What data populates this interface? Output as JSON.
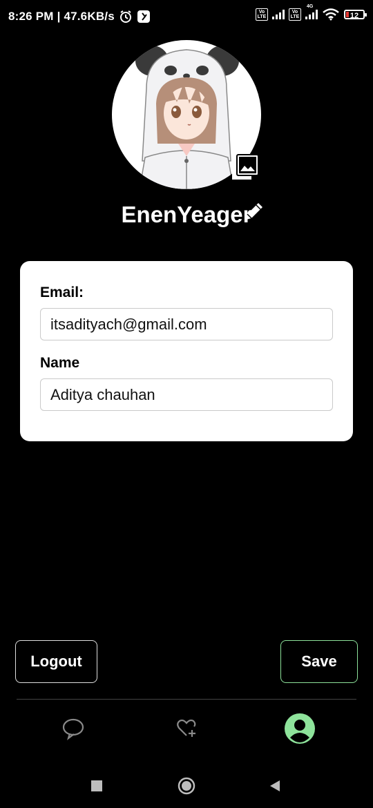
{
  "status_bar": {
    "time_speed": "8:26 PM | 47.6KB/s",
    "sim1_badge": "Vo LTE",
    "sim2_badge": "Vo LTE",
    "network_type": "4G",
    "battery_level": "12"
  },
  "profile": {
    "username": "EnenYeager"
  },
  "form": {
    "email_label": "Email:",
    "email_value": "itsadityach@gmail.com",
    "name_label": "Name",
    "name_value": "Aditya chauhan"
  },
  "actions": {
    "logout_label": "Logout",
    "save_label": "Save"
  },
  "bottom_nav": {
    "items": [
      {
        "icon": "chat-icon"
      },
      {
        "icon": "heart-plus-icon"
      },
      {
        "icon": "profile-icon",
        "active": true
      }
    ]
  },
  "colors": {
    "background": "#000000",
    "card": "#ffffff",
    "accent": "#8ee39b"
  }
}
